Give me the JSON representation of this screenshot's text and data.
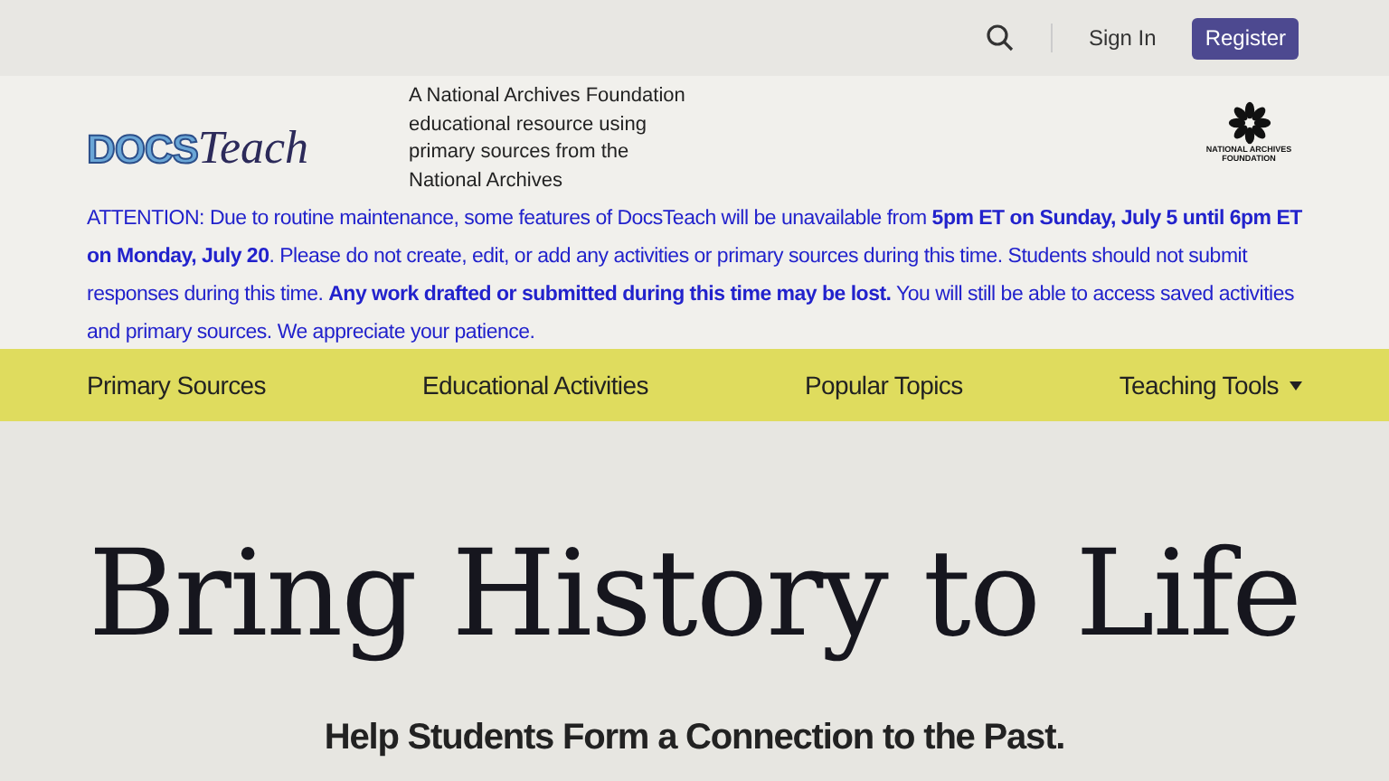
{
  "top_bar": {
    "sign_in": "Sign In",
    "register": "Register"
  },
  "header": {
    "logo": {
      "part_1": "DOCS",
      "part_2": "Teach"
    },
    "tagline": "A National Archives Foundation educational resource using primary sources from the National Archives",
    "partner_logo": "NATIONAL ARCHIVES FOUNDATION"
  },
  "alert": "ATTENTION: Due to routine maintenance, some features of DocsTeach will be unavailable from **5pm ET on Sunday, July 5 until 6pm ET on Monday, July 20**. Please do not create, edit, or add any activities or primary sources during this time. Students should not submit responses during this time. **Any work drafted or submitted during this time may be lost.** You will still be able to access saved activities and primary sources. We appreciate your patience.",
  "nav": {
    "items": [
      {
        "label": "Primary Sources",
        "dropdown": false
      },
      {
        "label": "Educational Activities",
        "dropdown": false
      },
      {
        "label": "Popular Topics",
        "dropdown": false
      },
      {
        "label": "Teaching Tools",
        "dropdown": true
      }
    ]
  },
  "hero": {
    "title": "Bring History to Life",
    "subtitle": "Help Students Form a Connection to the Past."
  }
}
